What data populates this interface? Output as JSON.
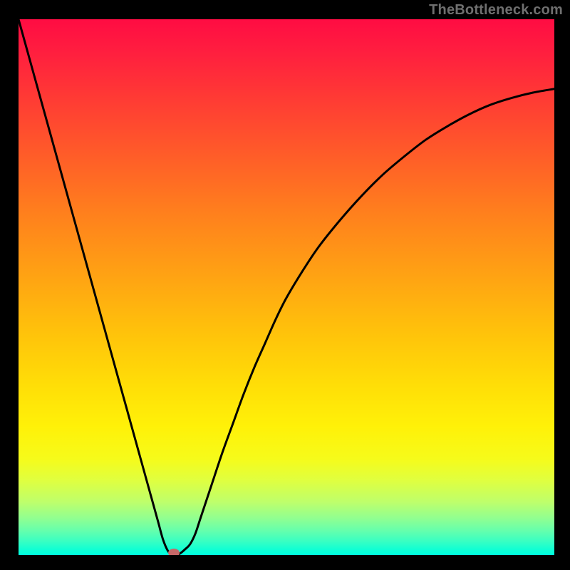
{
  "watermark": "TheBottleneck.com",
  "chart_data": {
    "type": "line",
    "title": "",
    "xlabel": "",
    "ylabel": "",
    "xlim": [
      0,
      100
    ],
    "ylim": [
      0,
      100
    ],
    "series": [
      {
        "name": "bottleneck-curve",
        "x": [
          0,
          2,
          4,
          6,
          8,
          10,
          12,
          14,
          16,
          18,
          20,
          22,
          24,
          26,
          27,
          28,
          29,
          30,
          31,
          32,
          33,
          34,
          36,
          38,
          40,
          42,
          44,
          46,
          48,
          50,
          53,
          56,
          60,
          64,
          68,
          72,
          76,
          80,
          84,
          88,
          92,
          96,
          100
        ],
        "y": [
          100,
          92.8,
          85.6,
          78.4,
          71.2,
          64,
          56.8,
          49.6,
          42.4,
          35.2,
          28,
          20.8,
          13.6,
          6.4,
          2.8,
          0.6,
          0,
          0.2,
          1.0,
          2.0,
          4,
          7,
          13,
          19,
          24.5,
          30,
          35,
          39.5,
          44,
          48,
          53,
          57.5,
          62.5,
          67,
          71,
          74.4,
          77.5,
          80,
          82.2,
          84.0,
          85.3,
          86.3,
          87.0
        ]
      }
    ],
    "annotations": [
      {
        "name": "marker-dot",
        "x": 29,
        "y": 0,
        "color": "#c66868"
      }
    ],
    "gradient_stops": [
      {
        "pos": 0,
        "color": "#ff0c43"
      },
      {
        "pos": 50,
        "color": "#ffb010"
      },
      {
        "pos": 80,
        "color": "#ffff10"
      },
      {
        "pos": 100,
        "color": "#00ffde"
      }
    ]
  }
}
